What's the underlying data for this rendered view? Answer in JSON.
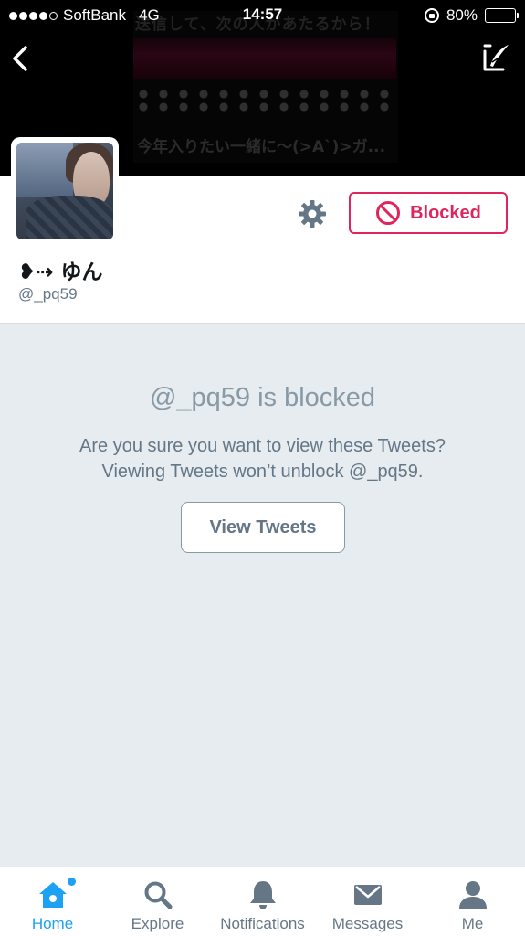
{
  "status_bar": {
    "carrier": "SoftBank",
    "network": "4G",
    "time": "14:57",
    "battery": "80%",
    "battery_level": 0.8,
    "signal_bars": 4
  },
  "header": {
    "banner_text_top": "送信して、次の人があたるから！",
    "banner_text_bottom": "今年入りたい一緒に〜(>A`)>ガ..."
  },
  "profile": {
    "name": "❥⇢ ゆん",
    "handle": "@_pq59",
    "blocked_label": "Blocked"
  },
  "notice": {
    "title": "@_pq59 is blocked",
    "line1": "Are you sure you want to view these Tweets?",
    "line2": "Viewing Tweets won’t unblock @_pq59.",
    "view_button": "View Tweets"
  },
  "tabs": [
    {
      "label": "Home",
      "icon": "home-icon",
      "active": true
    },
    {
      "label": "Explore",
      "icon": "search-icon",
      "active": false
    },
    {
      "label": "Notifications",
      "icon": "bell-icon",
      "active": false
    },
    {
      "label": "Messages",
      "icon": "envelope-icon",
      "active": false
    },
    {
      "label": "Me",
      "icon": "person-icon",
      "active": false
    }
  ],
  "colors": {
    "accent": "#1da1f2",
    "blocked_red": "#e0245e",
    "muted": "#657786",
    "background": "#e6ecf0"
  }
}
